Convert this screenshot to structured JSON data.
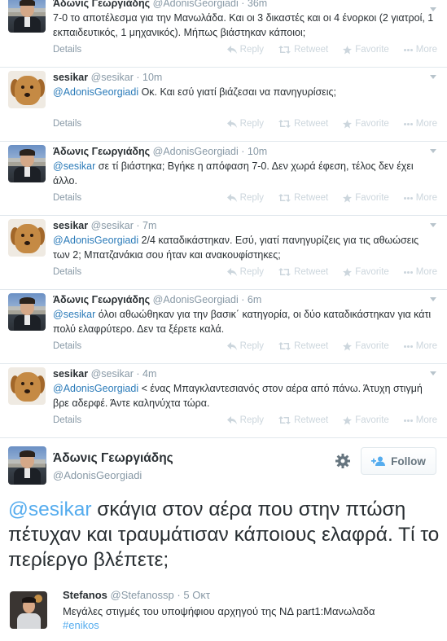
{
  "tweets": [
    {
      "avatar": "adonis",
      "name": "Άδωνις Γεωργιάδης",
      "handle": "@AdonisGeorgiadi",
      "time": "36m",
      "mention": "",
      "text": "7-0 το αποτέλεσμα για την Μανωλάδα. Και οι 3 δικαστές και οι 4 ένορκοι (2 γιατροί, 1 εκπαιδευτικός, 1 μηχανικός). Μήπως βιάστηκαν κάποιοι;"
    },
    {
      "avatar": "dog",
      "name": "sesikar",
      "handle": "@sesikar",
      "time": "10m",
      "mention": "@AdonisGeorgiadi",
      "text": " Οκ. Και εσύ γιατί βιάζεσαι να πανηγυρίσεις;"
    },
    {
      "avatar": "adonis",
      "name": "Άδωνις Γεωργιάδης",
      "handle": "@AdonisGeorgiadi",
      "time": "10m",
      "mention": "@sesikar",
      "text": " σε τί βιάστηκα; Βγήκε η απόφαση 7-0. Δεν χωρά έφεση, τέλος δεν έχει άλλο."
    },
    {
      "avatar": "dog",
      "name": "sesikar",
      "handle": "@sesikar",
      "time": "7m",
      "mention": "@AdonisGeorgiadi",
      "text": " 2/4 καταδικάστηκαν. Εσύ, γιατί πανηγυρίζεις για τις αθωώσεις των 2; Μπατζανάκια σου ήταν και ανακουφίστηκες;"
    },
    {
      "avatar": "adonis",
      "name": "Άδωνις Γεωργιάδης",
      "handle": "@AdonisGeorgiadi",
      "time": "6m",
      "mention": "@sesikar",
      "text": " όλοι αθωώθηκαν για την βασικ΄ κατηγορία, οι δύο καταδικάστηκαν για κάτι πολύ ελαφρύτερο. Δεν τα ξέρετε καλά."
    },
    {
      "avatar": "dog",
      "name": "sesikar",
      "handle": "@sesikar",
      "time": "4m",
      "mention": "@AdonisGeorgiadi",
      "text": " < ένας Μπαγκλαντεσιανός στον αέρα από πάνω. Άτυχη στιγμή βρε αδερφέ. Άντε καληνύχτα τώρα."
    }
  ],
  "tweet_footer": {
    "details": "Details",
    "reply": "Reply",
    "retweet": "Retweet",
    "favorite": "Favorite",
    "more": "More"
  },
  "expanded": {
    "name": "Άδωνις Γεωργιάδης",
    "handle": "@AdonisGeorgiadi",
    "follow_label": "Follow",
    "mention": "@sesikar",
    "text": " σκάγια στον αέρα που στην πτώση πέτυχαν και τραυμάτισαν κάποιους ελαφρά. Τί το περίεργο βλέπετε;"
  },
  "reply": {
    "name": "Stefanos",
    "handle": "@Stefanossp",
    "time": "5 Οκτ",
    "text": "Μεγάλες στιγμές του υποψήφιου αρχηγού της ΝΔ part1:Μανωλαδα",
    "hashtag": "#enikos"
  },
  "colors": {
    "link": "#2b7bb9",
    "muted": "#8899a6",
    "action_faded": "#ccd6dd"
  }
}
